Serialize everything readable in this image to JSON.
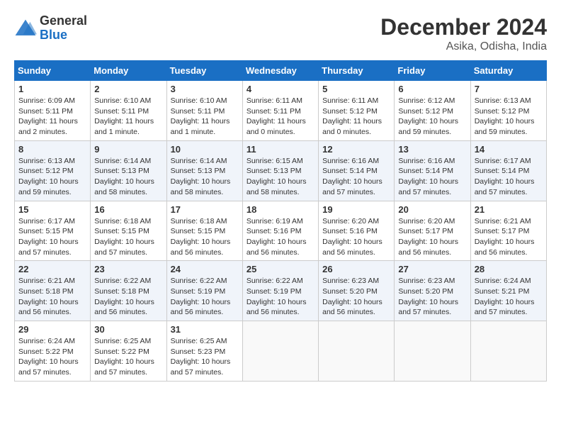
{
  "header": {
    "logo_general": "General",
    "logo_blue": "Blue",
    "month_title": "December 2024",
    "location": "Asika, Odisha, India"
  },
  "weekdays": [
    "Sunday",
    "Monday",
    "Tuesday",
    "Wednesday",
    "Thursday",
    "Friday",
    "Saturday"
  ],
  "weeks": [
    [
      {
        "day": "1",
        "sunrise": "6:09 AM",
        "sunset": "5:11 PM",
        "daylight": "11 hours and 2 minutes."
      },
      {
        "day": "2",
        "sunrise": "6:10 AM",
        "sunset": "5:11 PM",
        "daylight": "11 hours and 1 minute."
      },
      {
        "day": "3",
        "sunrise": "6:10 AM",
        "sunset": "5:11 PM",
        "daylight": "11 hours and 1 minute."
      },
      {
        "day": "4",
        "sunrise": "6:11 AM",
        "sunset": "5:11 PM",
        "daylight": "11 hours and 0 minutes."
      },
      {
        "day": "5",
        "sunrise": "6:11 AM",
        "sunset": "5:12 PM",
        "daylight": "11 hours and 0 minutes."
      },
      {
        "day": "6",
        "sunrise": "6:12 AM",
        "sunset": "5:12 PM",
        "daylight": "10 hours and 59 minutes."
      },
      {
        "day": "7",
        "sunrise": "6:13 AM",
        "sunset": "5:12 PM",
        "daylight": "10 hours and 59 minutes."
      }
    ],
    [
      {
        "day": "8",
        "sunrise": "6:13 AM",
        "sunset": "5:12 PM",
        "daylight": "10 hours and 59 minutes."
      },
      {
        "day": "9",
        "sunrise": "6:14 AM",
        "sunset": "5:13 PM",
        "daylight": "10 hours and 58 minutes."
      },
      {
        "day": "10",
        "sunrise": "6:14 AM",
        "sunset": "5:13 PM",
        "daylight": "10 hours and 58 minutes."
      },
      {
        "day": "11",
        "sunrise": "6:15 AM",
        "sunset": "5:13 PM",
        "daylight": "10 hours and 58 minutes."
      },
      {
        "day": "12",
        "sunrise": "6:16 AM",
        "sunset": "5:14 PM",
        "daylight": "10 hours and 57 minutes."
      },
      {
        "day": "13",
        "sunrise": "6:16 AM",
        "sunset": "5:14 PM",
        "daylight": "10 hours and 57 minutes."
      },
      {
        "day": "14",
        "sunrise": "6:17 AM",
        "sunset": "5:14 PM",
        "daylight": "10 hours and 57 minutes."
      }
    ],
    [
      {
        "day": "15",
        "sunrise": "6:17 AM",
        "sunset": "5:15 PM",
        "daylight": "10 hours and 57 minutes."
      },
      {
        "day": "16",
        "sunrise": "6:18 AM",
        "sunset": "5:15 PM",
        "daylight": "10 hours and 57 minutes."
      },
      {
        "day": "17",
        "sunrise": "6:18 AM",
        "sunset": "5:15 PM",
        "daylight": "10 hours and 56 minutes."
      },
      {
        "day": "18",
        "sunrise": "6:19 AM",
        "sunset": "5:16 PM",
        "daylight": "10 hours and 56 minutes."
      },
      {
        "day": "19",
        "sunrise": "6:20 AM",
        "sunset": "5:16 PM",
        "daylight": "10 hours and 56 minutes."
      },
      {
        "day": "20",
        "sunrise": "6:20 AM",
        "sunset": "5:17 PM",
        "daylight": "10 hours and 56 minutes."
      },
      {
        "day": "21",
        "sunrise": "6:21 AM",
        "sunset": "5:17 PM",
        "daylight": "10 hours and 56 minutes."
      }
    ],
    [
      {
        "day": "22",
        "sunrise": "6:21 AM",
        "sunset": "5:18 PM",
        "daylight": "10 hours and 56 minutes."
      },
      {
        "day": "23",
        "sunrise": "6:22 AM",
        "sunset": "5:18 PM",
        "daylight": "10 hours and 56 minutes."
      },
      {
        "day": "24",
        "sunrise": "6:22 AM",
        "sunset": "5:19 PM",
        "daylight": "10 hours and 56 minutes."
      },
      {
        "day": "25",
        "sunrise": "6:22 AM",
        "sunset": "5:19 PM",
        "daylight": "10 hours and 56 minutes."
      },
      {
        "day": "26",
        "sunrise": "6:23 AM",
        "sunset": "5:20 PM",
        "daylight": "10 hours and 56 minutes."
      },
      {
        "day": "27",
        "sunrise": "6:23 AM",
        "sunset": "5:20 PM",
        "daylight": "10 hours and 57 minutes."
      },
      {
        "day": "28",
        "sunrise": "6:24 AM",
        "sunset": "5:21 PM",
        "daylight": "10 hours and 57 minutes."
      }
    ],
    [
      {
        "day": "29",
        "sunrise": "6:24 AM",
        "sunset": "5:22 PM",
        "daylight": "10 hours and 57 minutes."
      },
      {
        "day": "30",
        "sunrise": "6:25 AM",
        "sunset": "5:22 PM",
        "daylight": "10 hours and 57 minutes."
      },
      {
        "day": "31",
        "sunrise": "6:25 AM",
        "sunset": "5:23 PM",
        "daylight": "10 hours and 57 minutes."
      },
      null,
      null,
      null,
      null
    ]
  ],
  "labels": {
    "sunrise": "Sunrise: ",
    "sunset": "Sunset: ",
    "daylight": "Daylight: "
  }
}
